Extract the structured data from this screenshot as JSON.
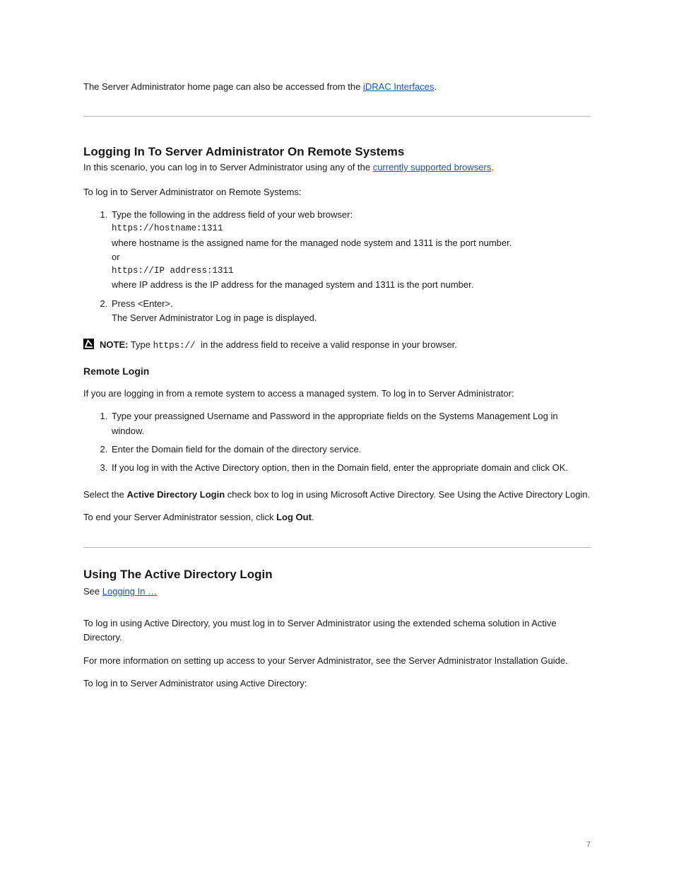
{
  "intro": {
    "prefix": "The Server Administrator home page can also be accessed from the ",
    "linked": "iDRAC Interfaces",
    "suffix": "."
  },
  "section1": {
    "title": "Logging In To Server Administrator On Remote Systems",
    "subPrefix": "In this scenario, you can log in to Server Administrator using any of the ",
    "subLink": "currently supported browsers",
    "subSuffix": ".",
    "p1": "To log in to Server Administrator on Remote Systems:",
    "steps": [
      {
        "lead": "Type the following in the address field of your web browser:",
        "codeLine1": "https://hostname:1311",
        "codeLine2": "where hostname is the assigned name for the managed node system and 1311 is the port number.",
        "or": "or",
        "codeLine3": "https://IP address:1311",
        "codeLine4": "where IP address is the IP address for the managed system and 1311 is the port number."
      },
      {
        "text": "Press <Enter>.",
        "after": "The Server Administrator Log in page is displayed."
      }
    ],
    "note": {
      "label": "NOTE:",
      "textPrefix": " Type ",
      "textCode": "https:// ",
      "textSuffix": "in the address field to receive a valid response in your browser."
    },
    "subheader": "Remote Login",
    "p2": "If you are logging in from a remote system to access a managed system. To log in to Server Administrator:",
    "remoteSteps": [
      "Type your preassigned Username and Password in the appropriate fields on the Systems Management Log in window.",
      "Enter the Domain field for the domain of the directory service.",
      "If you log in with the Active Directory option, then in the Domain field, enter the appropriate domain and click OK."
    ],
    "p3Prefix": "Select the ",
    "p3Link": "Active Directory Login",
    "p3Mid": " check box to log in using Microsoft Active Directory. See ",
    "p3Link2": "Using the Active Directory Login",
    "p3Suffix": ".",
    "p4Prefix": "To end your Server Administrator session, click ",
    "p4Bold": "Log Out",
    "p4Suffix": ".",
    "spacer": " "
  },
  "section2": {
    "title": "Using The Active Directory Login",
    "subPrefix": "See ",
    "subLink": "Logging In …",
    "subSuffix": "",
    "p1": "To log in using Active Directory, you must log in to Server Administrator using the extended schema solution in Active Directory.",
    "p2": "For more information on setting up access to your Server Administrator, see the Server Administrator Installation Guide.",
    "p3": "To log in to Server Administrator using Active Directory:"
  },
  "footer": "7"
}
